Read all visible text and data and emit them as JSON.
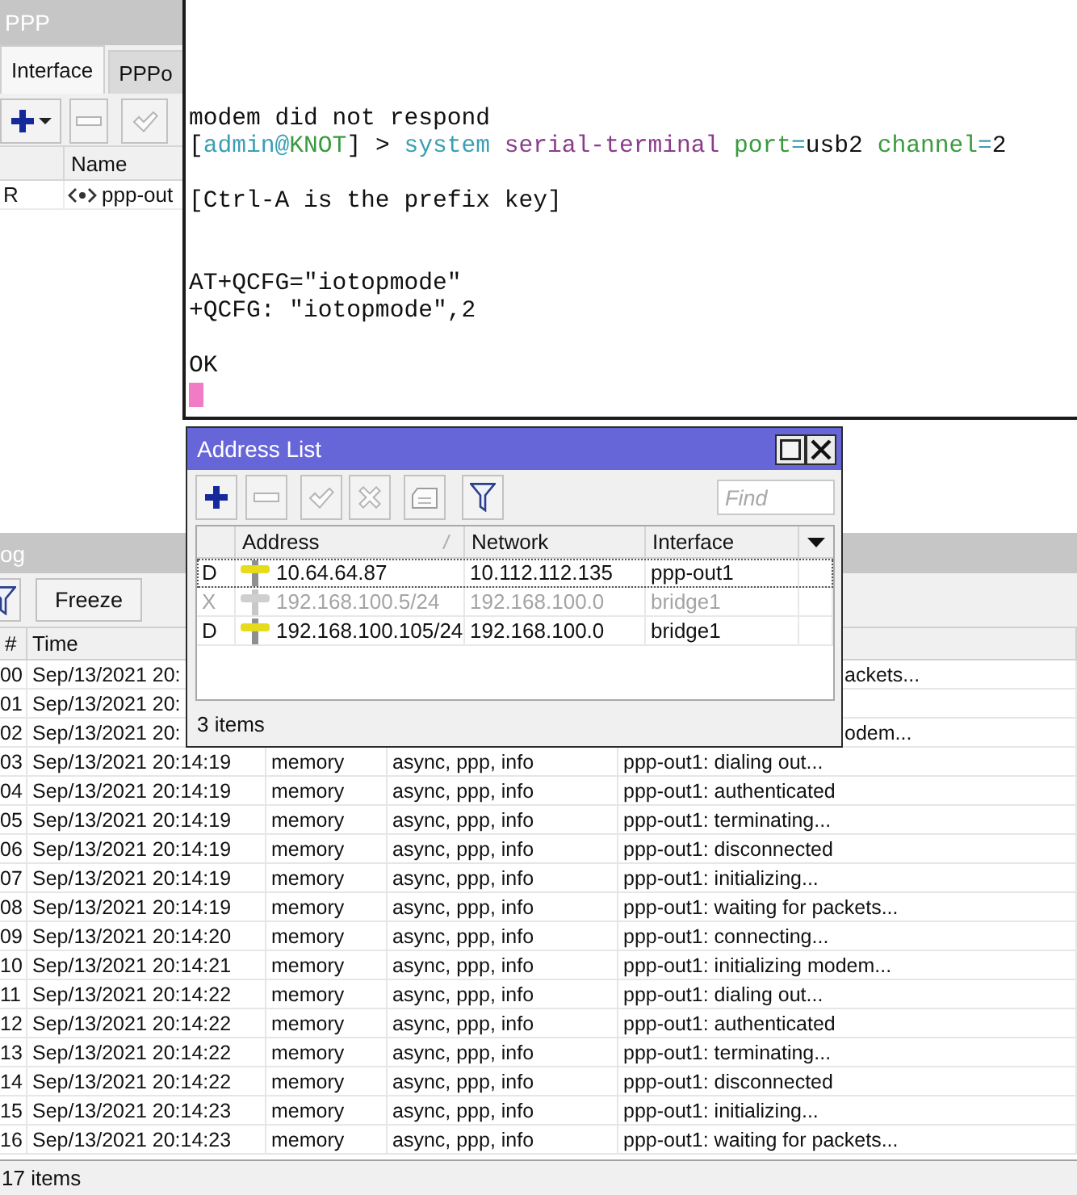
{
  "ppp_window": {
    "title": "PPP",
    "tabs": [
      {
        "label": "Interface",
        "selected": true
      },
      {
        "label": "PPPo",
        "selected": false
      }
    ],
    "columns": [
      "Name"
    ],
    "rows": [
      {
        "flag": "R",
        "name": "ppp-out"
      }
    ]
  },
  "terminal": {
    "lines": [
      {
        "kind": "text",
        "segments": [
          {
            "text": "modem did not respond",
            "color": "#111111"
          }
        ]
      },
      {
        "kind": "text",
        "segments": [
          {
            "text": "[",
            "color": "#111111"
          },
          {
            "text": "admin@",
            "color": "#3a9fb3"
          },
          {
            "text": "KNOT",
            "color": "#3a9a3e"
          },
          {
            "text": "] > ",
            "color": "#111111"
          },
          {
            "text": "system ",
            "color": "#3a9fb3"
          },
          {
            "text": "serial-terminal ",
            "color": "#8a3c8c"
          },
          {
            "text": "port",
            "color": "#3a9a3e"
          },
          {
            "text": "=",
            "color": "#3a9fb3"
          },
          {
            "text": "usb2 ",
            "color": "#111111"
          },
          {
            "text": "channel",
            "color": "#3a9a3e"
          },
          {
            "text": "=",
            "color": "#3a9fb3"
          },
          {
            "text": "2",
            "color": "#111111"
          }
        ]
      },
      {
        "kind": "blank"
      },
      {
        "kind": "text",
        "segments": [
          {
            "text": "[Ctrl-A is the prefix key]",
            "color": "#111111"
          }
        ]
      },
      {
        "kind": "blank"
      },
      {
        "kind": "blank"
      },
      {
        "kind": "text",
        "segments": [
          {
            "text": "AT+QCFG=\"iotopmode\"",
            "color": "#111111"
          }
        ]
      },
      {
        "kind": "text",
        "segments": [
          {
            "text": "+QCFG: \"iotopmode\",2",
            "color": "#111111"
          }
        ]
      },
      {
        "kind": "blank"
      },
      {
        "kind": "text",
        "segments": [
          {
            "text": "OK",
            "color": "#111111"
          }
        ]
      },
      {
        "kind": "cursor",
        "color": "#f07cc6"
      }
    ]
  },
  "log_window": {
    "title": "og",
    "freeze_button": "Freeze",
    "columns": [
      "#",
      "Time"
    ],
    "rows": [
      {
        "kind": "covered",
        "number": "00",
        "time": "Sep/13/2021 20:",
        "message": "ackets..."
      },
      {
        "kind": "covered",
        "number": "01",
        "time": "Sep/13/2021 20:"
      },
      {
        "kind": "covered",
        "number": "02",
        "time": "Sep/13/2021 20:",
        "message": "odem..."
      },
      {
        "kind": "full",
        "number": "03",
        "time": "Sep/13/2021 20:14:19",
        "buffer": "memory",
        "topics": "async, ppp, info",
        "message": "ppp-out1: dialing out..."
      },
      {
        "kind": "full",
        "number": "04",
        "time": "Sep/13/2021 20:14:19",
        "buffer": "memory",
        "topics": "async, ppp, info",
        "message": "ppp-out1: authenticated"
      },
      {
        "kind": "full",
        "number": "05",
        "time": "Sep/13/2021 20:14:19",
        "buffer": "memory",
        "topics": "async, ppp, info",
        "message": "ppp-out1: terminating..."
      },
      {
        "kind": "full",
        "number": "06",
        "time": "Sep/13/2021 20:14:19",
        "buffer": "memory",
        "topics": "async, ppp, info",
        "message": "ppp-out1: disconnected"
      },
      {
        "kind": "full",
        "number": "07",
        "time": "Sep/13/2021 20:14:19",
        "buffer": "memory",
        "topics": "async, ppp, info",
        "message": "ppp-out1: initializing..."
      },
      {
        "kind": "full",
        "number": "08",
        "time": "Sep/13/2021 20:14:19",
        "buffer": "memory",
        "topics": "async, ppp, info",
        "message": "ppp-out1: waiting for packets..."
      },
      {
        "kind": "full",
        "number": "09",
        "time": "Sep/13/2021 20:14:20",
        "buffer": "memory",
        "topics": "async, ppp, info",
        "message": "ppp-out1: connecting..."
      },
      {
        "kind": "full",
        "number": "10",
        "time": "Sep/13/2021 20:14:21",
        "buffer": "memory",
        "topics": "async, ppp, info",
        "message": "ppp-out1: initializing modem..."
      },
      {
        "kind": "full",
        "number": "11",
        "time": "Sep/13/2021 20:14:22",
        "buffer": "memory",
        "topics": "async, ppp, info",
        "message": "ppp-out1: dialing out..."
      },
      {
        "kind": "full",
        "number": "12",
        "time": "Sep/13/2021 20:14:22",
        "buffer": "memory",
        "topics": "async, ppp, info",
        "message": "ppp-out1: authenticated"
      },
      {
        "kind": "full",
        "number": "13",
        "time": "Sep/13/2021 20:14:22",
        "buffer": "memory",
        "topics": "async, ppp, info",
        "message": "ppp-out1: terminating..."
      },
      {
        "kind": "full",
        "number": "14",
        "time": "Sep/13/2021 20:14:22",
        "buffer": "memory",
        "topics": "async, ppp, info",
        "message": "ppp-out1: disconnected"
      },
      {
        "kind": "full",
        "number": "15",
        "time": "Sep/13/2021 20:14:23",
        "buffer": "memory",
        "topics": "async, ppp, info",
        "message": "ppp-out1: initializing..."
      },
      {
        "kind": "full",
        "number": "16",
        "time": "Sep/13/2021 20:14:23",
        "buffer": "memory",
        "topics": "async, ppp, info",
        "message": "ppp-out1: waiting for packets..."
      }
    ],
    "status": "17 items"
  },
  "address_list": {
    "title": "Address List",
    "search": {
      "placeholder": "Find"
    },
    "columns": [
      "Address",
      "Network",
      "Interface"
    ],
    "rows": [
      {
        "flag": "D",
        "address": "10.64.64.87",
        "network": "10.112.112.135",
        "interface": "ppp-out1",
        "selected": true,
        "disabled": false
      },
      {
        "flag": "X",
        "address": "192.168.100.5/24",
        "network": "192.168.100.0",
        "interface": "bridge1",
        "selected": false,
        "disabled": true
      },
      {
        "flag": "D",
        "address": "192.168.100.105/24",
        "network": "192.168.100.0",
        "interface": "bridge1",
        "selected": false,
        "disabled": false
      }
    ],
    "status": "3 items"
  }
}
